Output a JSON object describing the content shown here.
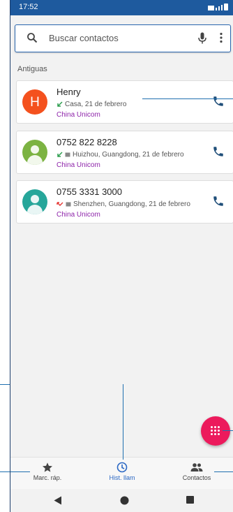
{
  "status": {
    "time": "17:52"
  },
  "search": {
    "placeholder": "Buscar contactos"
  },
  "section_label": "Antiguas",
  "calls": [
    {
      "initial": "H",
      "name": "Henry",
      "detail": "Casa, 21 de febrero",
      "carrier": "China Unicom",
      "avatar_color": "#f4511e",
      "call_type": "incoming",
      "status_color": "#2e9e4f"
    },
    {
      "initial": "",
      "name": "0752 822 8228",
      "detail": "Huizhou, Guangdong, 21 de febrero",
      "carrier": "China Unicom",
      "avatar_color": "#7cb342",
      "call_type": "incoming",
      "status_color": "#2e9e4f"
    },
    {
      "initial": "",
      "name": "0755 3331 3000",
      "detail": "Shenzhen, Guangdong, 21 de febrero",
      "carrier": "China Unicom",
      "avatar_color": "#26a69a",
      "call_type": "missed",
      "status_color": "#e53935"
    }
  ],
  "nav": {
    "speed_dial": "Marc. ráp.",
    "history": "Hist. llam",
    "contacts": "Contactos"
  },
  "colors": {
    "accent": "#2b68c4",
    "fab": "#ec1a5c",
    "statusbar": "#1e5a9e",
    "carrier": "#8e24aa"
  }
}
